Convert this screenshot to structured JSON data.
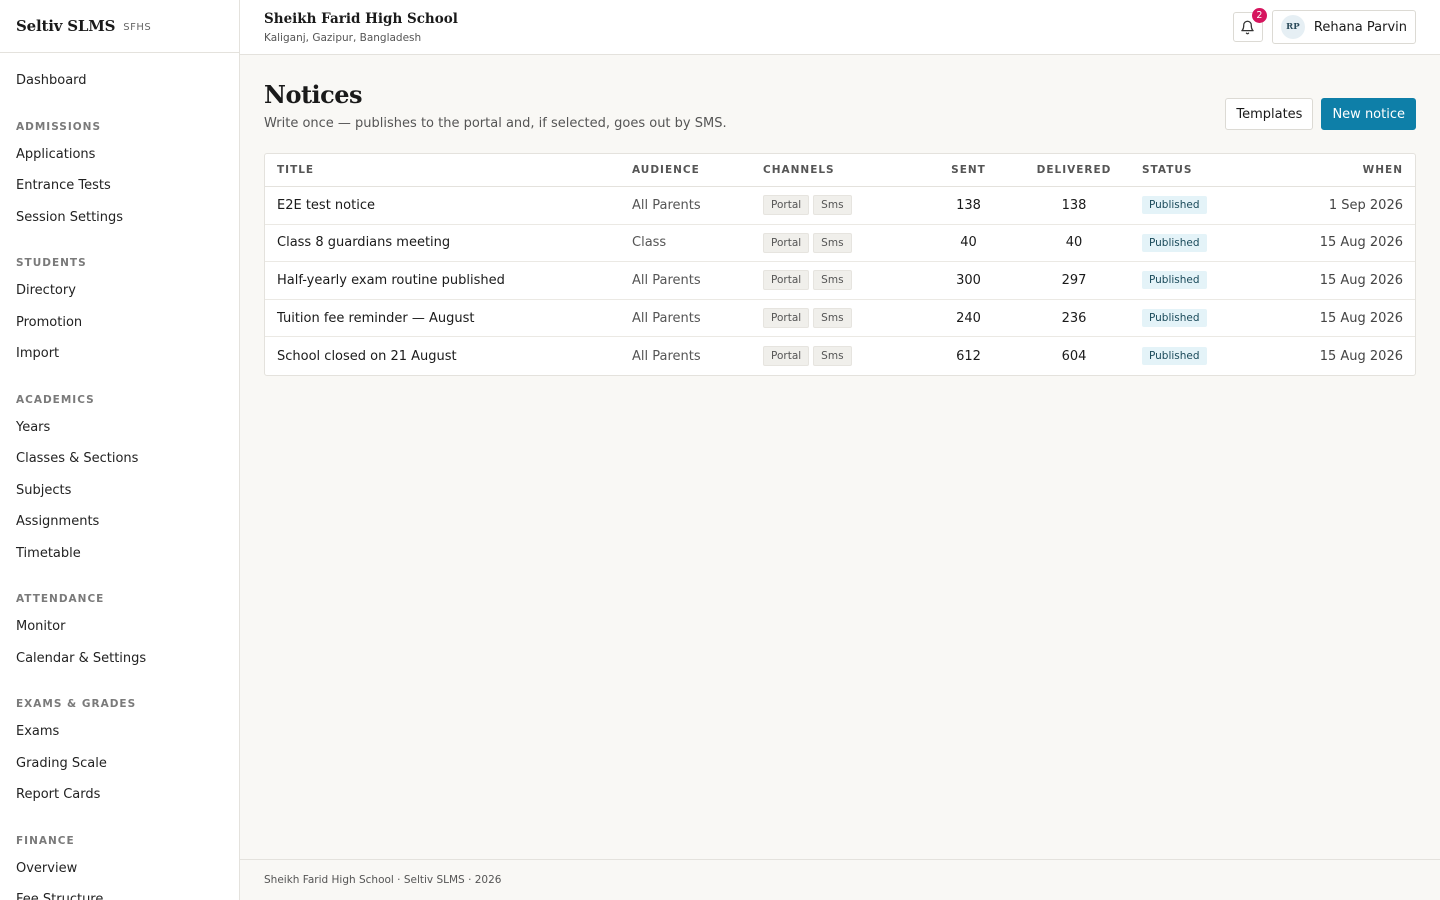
{
  "brand": {
    "name": "Seltiv SLMS",
    "code": "SFHS"
  },
  "nav": {
    "dashboard": "Dashboard",
    "sections": [
      {
        "title": "ADMISSIONS",
        "items": [
          "Applications",
          "Entrance Tests",
          "Session Settings"
        ]
      },
      {
        "title": "STUDENTS",
        "items": [
          "Directory",
          "Promotion",
          "Import"
        ]
      },
      {
        "title": "ACADEMICS",
        "items": [
          "Years",
          "Classes & Sections",
          "Subjects",
          "Assignments",
          "Timetable"
        ]
      },
      {
        "title": "ATTENDANCE",
        "items": [
          "Monitor",
          "Calendar & Settings"
        ]
      },
      {
        "title": "EXAMS & GRADES",
        "items": [
          "Exams",
          "Grading Scale",
          "Report Cards"
        ]
      },
      {
        "title": "FINANCE",
        "items": [
          "Overview",
          "Fee Structure"
        ]
      }
    ]
  },
  "header": {
    "school_name": "Sheikh Farid High School",
    "school_location": "Kaliganj, Gazipur, Bangladesh",
    "notification_count": "2",
    "user_initials": "RP",
    "user_name": "Rehana Parvin"
  },
  "page": {
    "title": "Notices",
    "subtitle": "Write once — publishes to the portal and, if selected, goes out by SMS.",
    "templates_label": "Templates",
    "new_notice_label": "New notice"
  },
  "table": {
    "headers": {
      "title": "TITLE",
      "audience": "AUDIENCE",
      "channels": "CHANNELS",
      "sent": "SENT",
      "delivered": "DELIVERED",
      "status": "STATUS",
      "when": "WHEN"
    },
    "rows": [
      {
        "title": "E2E test notice",
        "audience": "All Parents",
        "channels": [
          "Portal",
          "Sms"
        ],
        "sent": "138",
        "delivered": "138",
        "status": "Published",
        "when": "1 Sep 2026"
      },
      {
        "title": "Class 8 guardians meeting",
        "audience": "Class",
        "channels": [
          "Portal",
          "Sms"
        ],
        "sent": "40",
        "delivered": "40",
        "status": "Published",
        "when": "15 Aug 2026"
      },
      {
        "title": "Half-yearly exam routine published",
        "audience": "All Parents",
        "channels": [
          "Portal",
          "Sms"
        ],
        "sent": "300",
        "delivered": "297",
        "status": "Published",
        "when": "15 Aug 2026"
      },
      {
        "title": "Tuition fee reminder — August",
        "audience": "All Parents",
        "channels": [
          "Portal",
          "Sms"
        ],
        "sent": "240",
        "delivered": "236",
        "status": "Published",
        "when": "15 Aug 2026"
      },
      {
        "title": "School closed on 21 August",
        "audience": "All Parents",
        "channels": [
          "Portal",
          "Sms"
        ],
        "sent": "612",
        "delivered": "604",
        "status": "Published",
        "when": "15 Aug 2026"
      }
    ]
  },
  "footer": {
    "text": "Sheikh Farid High School · Seltiv SLMS · 2026"
  },
  "colors": {
    "accent": "#0e7fa8",
    "badge": "#d6155e",
    "status_bg": "#e4f3f8"
  }
}
